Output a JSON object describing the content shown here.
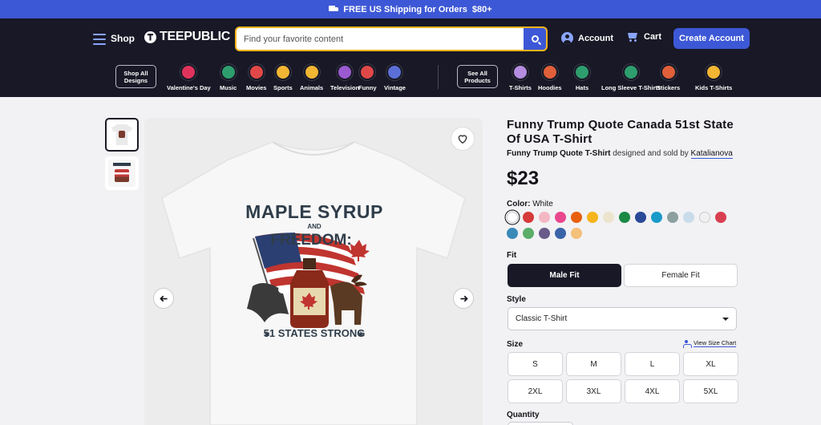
{
  "promo": {
    "text_prefix": "FREE US Shipping for Orders",
    "amount": "$80+"
  },
  "header": {
    "shop_label": "Shop",
    "logo_text": "TEEPUBLIC",
    "search_placeholder": "Find your favorite content",
    "account_label": "Account",
    "cart_label": "Cart",
    "create_account_label": "Create Account"
  },
  "categories": {
    "shop_all_designs": "Shop All Designs",
    "design_items": [
      {
        "label": "Valentine's Day",
        "icon": "heart-rocket-icon",
        "color": "#e0335c"
      },
      {
        "label": "Music",
        "icon": "cassette-icon",
        "color": "#2e9e6e"
      },
      {
        "label": "Movies",
        "icon": "popcorn-icon",
        "color": "#e04848"
      },
      {
        "label": "Sports",
        "icon": "racket-icon",
        "color": "#f2b632"
      },
      {
        "label": "Animals",
        "icon": "cat-icon",
        "color": "#f2b632"
      },
      {
        "label": "Television",
        "icon": "tv-icon",
        "color": "#9b5ad0"
      },
      {
        "label": "Funny",
        "icon": "laughing-face-icon",
        "color": "#e04848"
      },
      {
        "label": "Vintage",
        "icon": "retro-tv-icon",
        "color": "#5b6fd6"
      }
    ],
    "see_all_products": "See All Products",
    "product_items": [
      {
        "label": "T-Shirts",
        "icon": "tshirt-icon",
        "color": "#b58ce0"
      },
      {
        "label": "Hoodies",
        "icon": "hoodie-icon",
        "color": "#e0603a"
      },
      {
        "label": "Hats",
        "icon": "cap-icon",
        "color": "#2e9e6e"
      },
      {
        "label": "Long Sleeve T-Shirts",
        "icon": "long-sleeve-icon",
        "color": "#2e9e6e"
      },
      {
        "label": "Stickers",
        "icon": "sticker-icon",
        "color": "#e0603a"
      },
      {
        "label": "Kids T-Shirts",
        "icon": "kids-tshirt-icon",
        "color": "#f2b632"
      }
    ]
  },
  "product": {
    "title": "Funny Trump Quote Canada 51st State Of USA T-Shirt",
    "byline_product": "Funny Trump Quote T-Shirt",
    "byline_middle": "designed and sold by",
    "author": "Katalianova",
    "price": "$23",
    "color_label": "Color:",
    "color_value": "White",
    "swatches": [
      "#ffffff",
      "#d63a3a",
      "#f4b8c4",
      "#e8478e",
      "#e8600e",
      "#f4b41a",
      "#ece4cc",
      "#1a8a44",
      "#2a4a98",
      "#1a9ac8",
      "#8ca0a0",
      "#c8dcea",
      "#f0f0f0",
      "#d84050",
      "#3a8ab8",
      "#5aae6a",
      "#6a5a8a",
      "#3a64a8",
      "#f4c07a"
    ],
    "selected_swatch_index": 0,
    "design_lines": [
      "MAPLE SYRUP",
      "AND",
      "FREEDOM:",
      "51 STATES STRONG"
    ]
  },
  "options": {
    "fit_label": "Fit",
    "fit_options": [
      "Male Fit",
      "Female Fit"
    ],
    "fit_selected": "Male Fit",
    "style_label": "Style",
    "style_value": "Classic T-Shirt",
    "size_label": "Size",
    "size_chart_label": "View Size Chart",
    "sizes": [
      "S",
      "M",
      "L",
      "XL",
      "2XL",
      "3XL",
      "4XL",
      "5XL"
    ],
    "quantity_label": "Quantity"
  }
}
